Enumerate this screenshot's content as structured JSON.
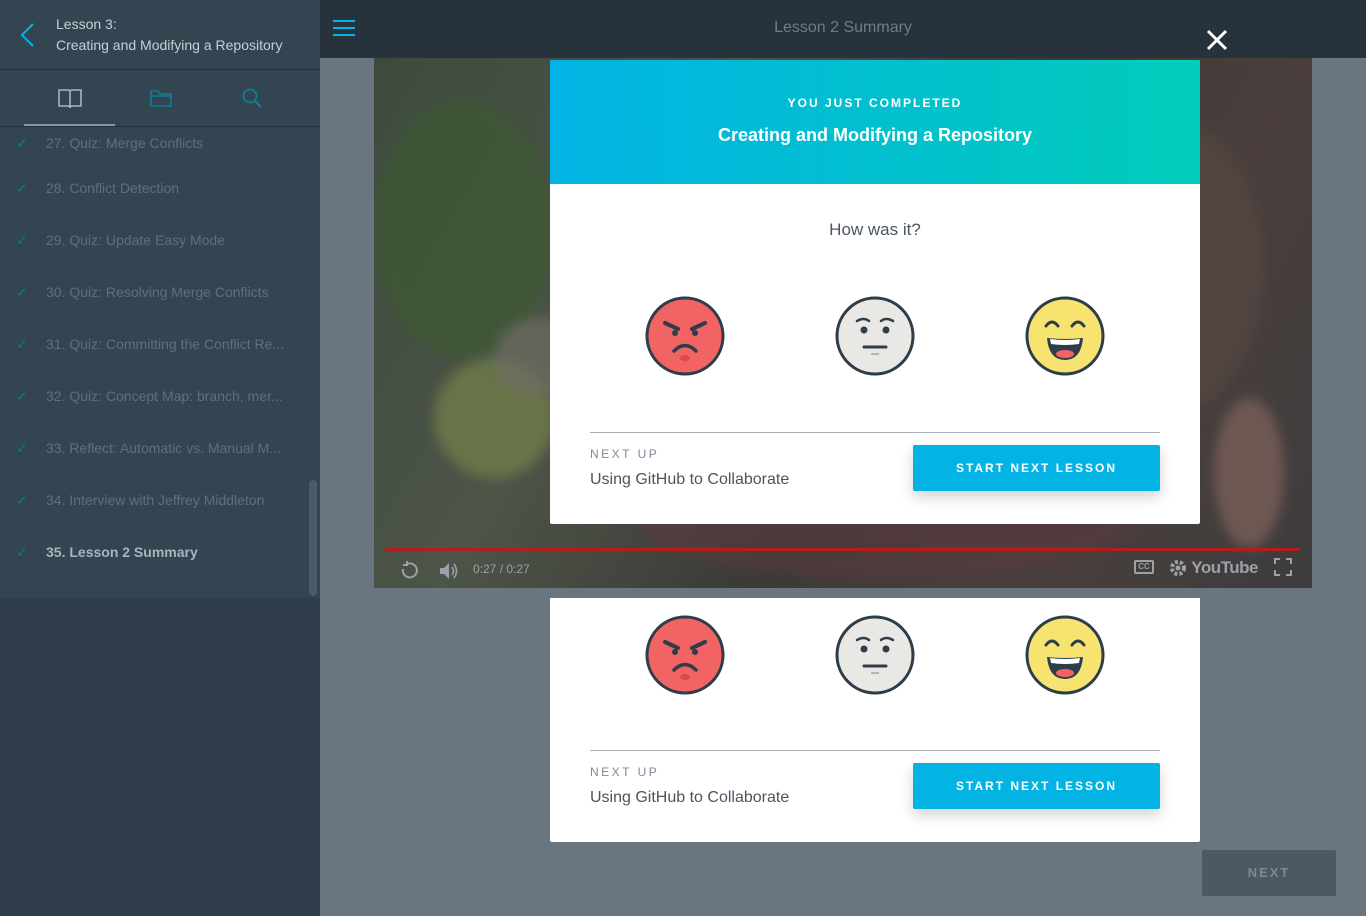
{
  "sidebar": {
    "lesson_number": "Lesson 3:",
    "lesson_title": "Creating and Modifying a Repository",
    "tabs": [
      "book-icon",
      "folder-icon",
      "search-icon"
    ],
    "concepts": [
      {
        "label": "27. Quiz: Merge Conflicts",
        "done": true
      },
      {
        "label": "28. Conflict Detection",
        "done": true
      },
      {
        "label": "29. Quiz: Update Easy Mode",
        "done": true
      },
      {
        "label": "30. Quiz: Resolving Merge Conflicts",
        "done": true
      },
      {
        "label": "31. Quiz: Committing the Conflict Re...",
        "done": true
      },
      {
        "label": "32. Quiz: Concept Map: branch, mer...",
        "done": true
      },
      {
        "label": "33. Reflect: Automatic vs. Manual M...",
        "done": true
      },
      {
        "label": "34. Interview with Jeffrey Middleton",
        "done": true
      },
      {
        "label": "35. Lesson 2 Summary",
        "done": true,
        "current": true
      }
    ]
  },
  "topbar": {
    "title": "Lesson 2 Summary"
  },
  "video": {
    "time": "0:27 / 0:27",
    "cc_label": "CC",
    "brand": "YouTube"
  },
  "modal": {
    "completed_label": "YOU JUST COMPLETED",
    "completed_title": "Creating and Modifying a Repository",
    "question": "How was it?",
    "ratings": [
      "angry-face-icon",
      "neutral-face-icon",
      "happy-face-icon"
    ],
    "next_up_label": "NEXT UP",
    "next_up_title": "Using GitHub to Collaborate",
    "start_button": "START NEXT LESSON"
  },
  "footer": {
    "next_button": "NEXT"
  },
  "colors": {
    "accent": "#02b3e4",
    "accent2": "#02ccba",
    "sidebar": "#2e3d49",
    "check": "#0c7e85"
  }
}
